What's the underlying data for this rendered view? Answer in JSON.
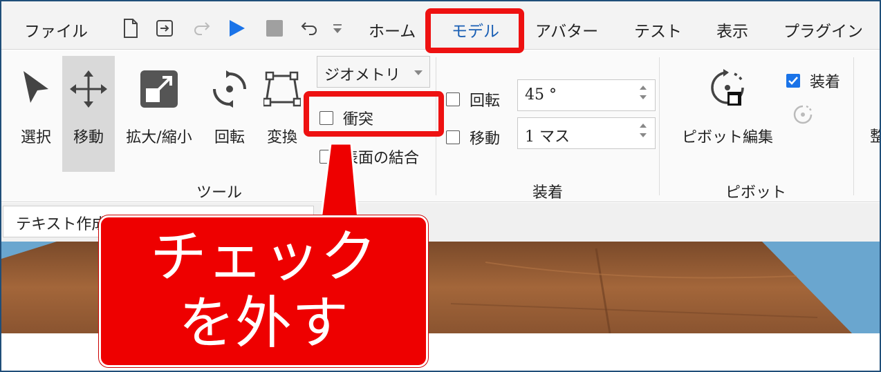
{
  "menu": {
    "file": "ファイル",
    "tabs": [
      "ホーム",
      "モデル",
      "アバター",
      "テスト",
      "表示",
      "プラグイン"
    ]
  },
  "ribbon": {
    "tools": [
      "選択",
      "移動",
      "拡大/縮小",
      "回転",
      "変換"
    ],
    "tools_group_label": "ツール",
    "geometry_dropdown": "ジオメトリ",
    "collision_label": "衝突",
    "join_surfaces_label": "表面の結合",
    "snap": {
      "rotate_label": "回転",
      "rotate_value": "45 °",
      "move_label": "移動",
      "move_value": "1 マス",
      "group_label": "装着"
    },
    "pivot": {
      "attach_label": "装着",
      "edit_label": "ピボット編集",
      "group_label": "ピボット"
    },
    "cut_off_label": "整"
  },
  "textbar": {
    "value": "テキスト作成"
  },
  "annotation": {
    "callout_text": "チェックを外す",
    "highlight_color": "#ee1111"
  },
  "colors": {
    "active_tab_text": "#1a5fb4",
    "play": "#1a73e8",
    "callout_bg": "#ee0000"
  }
}
